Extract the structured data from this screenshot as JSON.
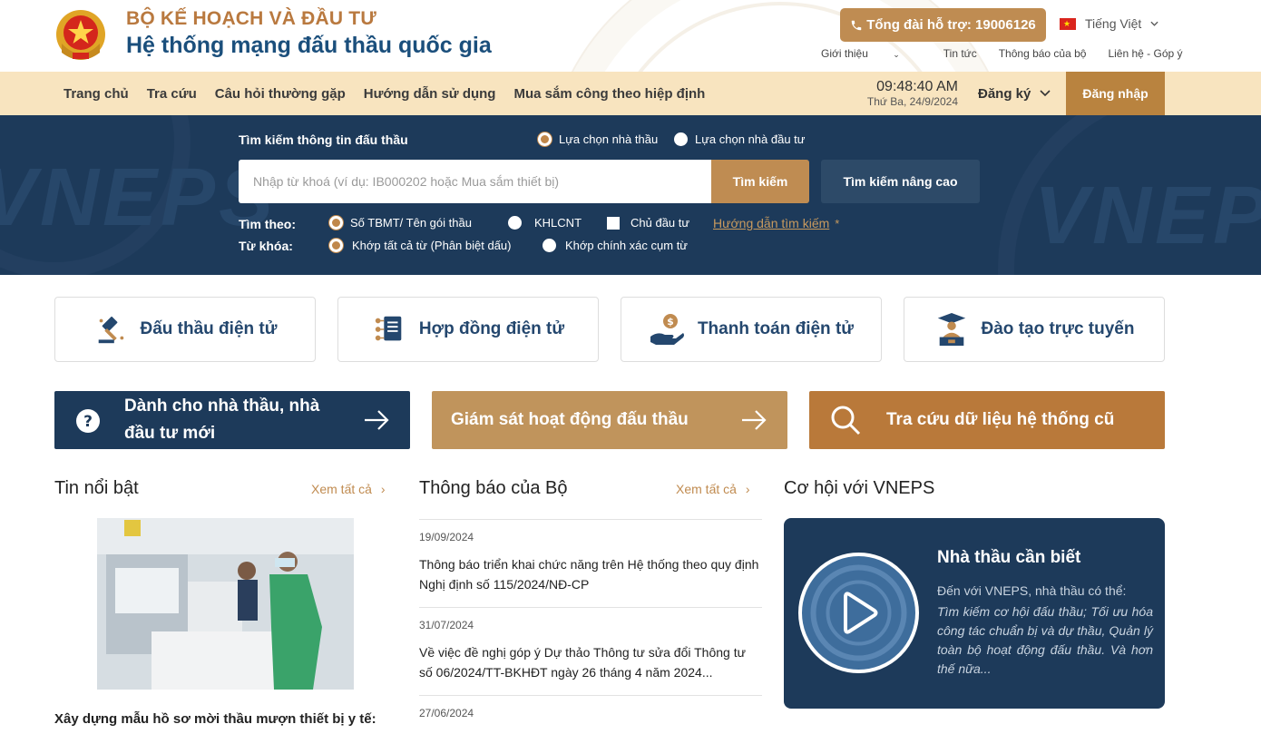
{
  "header": {
    "org_name": "BỘ KẾ HOẠCH VÀ ĐẦU TƯ",
    "system_name": "Hệ thống mạng đấu thầu quốc gia",
    "hotline": "Tổng đài hỗ trợ: 19006126",
    "language": "Tiếng Việt",
    "top_links": [
      "Giới thiệu",
      "Tin tức",
      "Thông báo của bộ",
      "Liên hệ - Góp ý"
    ]
  },
  "nav": {
    "items": [
      "Trang chủ",
      "Tra cứu",
      "Câu hỏi thường gặp",
      "Hướng dẫn sử dụng",
      "Mua sắm công theo hiệp định"
    ],
    "time": "09:48:40 AM",
    "date": "Thứ Ba, 24/9/2024",
    "register": "Đăng ký",
    "login": "Đăng nhập"
  },
  "search": {
    "title": "Tìm kiếm thông tin đấu thầu",
    "mode_options": [
      "Lựa chọn nhà thầu",
      "Lựa chọn nhà đầu tư"
    ],
    "mode_selected": "Lựa chọn nhà thầu",
    "placeholder": "Nhập từ khoá (ví dụ: IB000202 hoặc Mua sắm thiết bị)",
    "search_button": "Tìm kiếm",
    "advanced_button": "Tìm kiếm nâng cao",
    "search_by_label": "Tìm theo:",
    "search_by_options": [
      "Số TBMT/ Tên gói thầu",
      "KHLCNT",
      "Chủ đầu tư"
    ],
    "guide_link": "Hướng dẫn tìm kiếm",
    "guide_star": "*",
    "keyword_label": "Từ khóa:",
    "keyword_options": [
      "Khớp tất cả từ (Phân biệt dấu)",
      "Khớp chính xác cụm từ"
    ]
  },
  "services": [
    {
      "label": "Đấu thầu điện tử",
      "icon": "gavel-icon"
    },
    {
      "label": "Hợp đồng điện tử",
      "icon": "contract-icon"
    },
    {
      "label": "Thanh toán điện tử",
      "icon": "payment-icon"
    },
    {
      "label": "Đào tạo trực tuyến",
      "icon": "graduation-icon"
    }
  ],
  "banners": [
    {
      "label_line1": "Dành cho nhà thầu, nhà",
      "label_line2": "đầu tư mới",
      "color": "#1d3a5a"
    },
    {
      "label": "Giám sát hoạt động đấu thầu",
      "color": "#c0945c"
    },
    {
      "label": "Tra cứu dữ liệu hệ thống cũ",
      "color": "#b9793a"
    }
  ],
  "news": {
    "title": "Tin nổi bật",
    "see_all": "Xem tất cả",
    "caption": "Xây dựng mẫu hồ sơ mời thầu mượn thiết bị y tế:"
  },
  "announcements": {
    "title": "Thông báo của Bộ",
    "see_all": "Xem tất cả",
    "items": [
      {
        "date": "19/09/2024",
        "title": "Thông báo triển khai chức năng trên Hệ thống theo quy định Nghị định số 115/2024/NĐ-CP"
      },
      {
        "date": "31/07/2024",
        "title": "Về việc đề nghị góp ý Dự thảo Thông tư sửa đổi Thông tư số 06/2024/TT-BKHĐT ngày 26 tháng 4 năm 2024..."
      },
      {
        "date": "27/06/2024",
        "title": ""
      }
    ]
  },
  "opportunities": {
    "title": "Cơ hội với VNEPS",
    "card_title": "Nhà thầu cần biết",
    "card_sub": "Đến với VNEPS, nhà thầu có thể:",
    "card_desc": "Tìm kiếm cơ hội đấu thầu; Tối ưu hóa công tác chuẩn bị và dự thầu, Quản lý toàn bộ hoạt động đấu thầu. Và hơn thế nữa..."
  },
  "watermark": "VNEPS",
  "colors": {
    "navy": "#1d3a5a",
    "gold": "#bf8c52",
    "nav_bg": "#f8e4bf",
    "title_blue": "#1b4f7c"
  }
}
